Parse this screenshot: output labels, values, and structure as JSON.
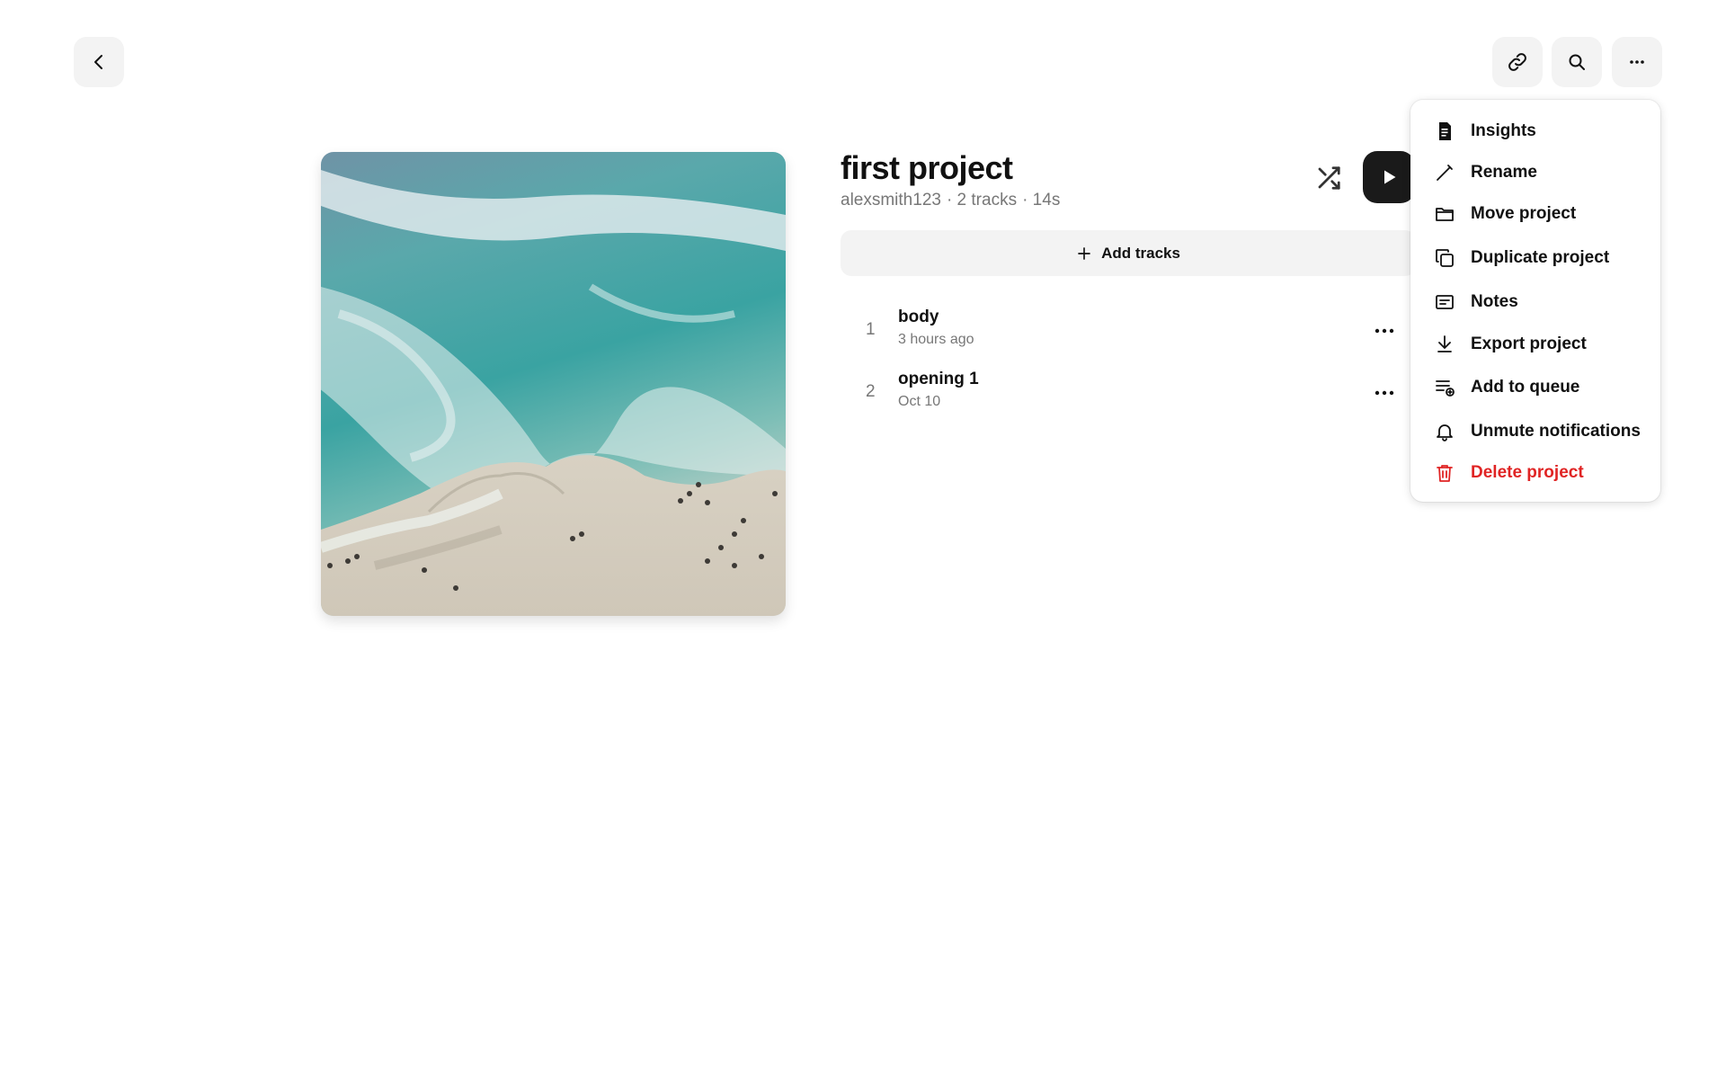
{
  "colors": {
    "accent": "#1a1a1a",
    "danger": "#e02424",
    "muted_text": "#777777",
    "button_bg": "#f3f3f3"
  },
  "header": {
    "back_icon": "chevron-left-icon",
    "link_icon": "link-icon",
    "search_icon": "search-icon",
    "more_icon": "more-horizontal-icon"
  },
  "project": {
    "title": "first project",
    "owner": "alexsmith123",
    "track_count": "· 2 tracks",
    "duration": "· 14s",
    "cover_icon": "beach-aerial-image"
  },
  "controls": {
    "shuffle_icon": "shuffle-icon",
    "play_icon": "play-icon"
  },
  "add_tracks": {
    "label": "Add tracks"
  },
  "tracks": [
    {
      "number": "1",
      "name": "body",
      "meta": "3 hours ago"
    },
    {
      "number": "2",
      "name": "opening 1",
      "meta": "Oct 10"
    }
  ],
  "menu": {
    "items": [
      {
        "label": "Insights",
        "icon": "document-icon"
      },
      {
        "label": "Rename",
        "icon": "pencil-icon"
      },
      {
        "label": "Move project",
        "icon": "folder-icon"
      },
      {
        "label": "Duplicate project",
        "icon": "duplicate-icon"
      },
      {
        "label": "Notes",
        "icon": "notes-icon"
      },
      {
        "label": "Export project",
        "icon": "download-icon"
      },
      {
        "label": "Add to queue",
        "icon": "queue-add-icon"
      },
      {
        "label": "Unmute notifications",
        "icon": "bell-icon"
      },
      {
        "label": "Delete project",
        "icon": "trash-icon"
      }
    ]
  }
}
